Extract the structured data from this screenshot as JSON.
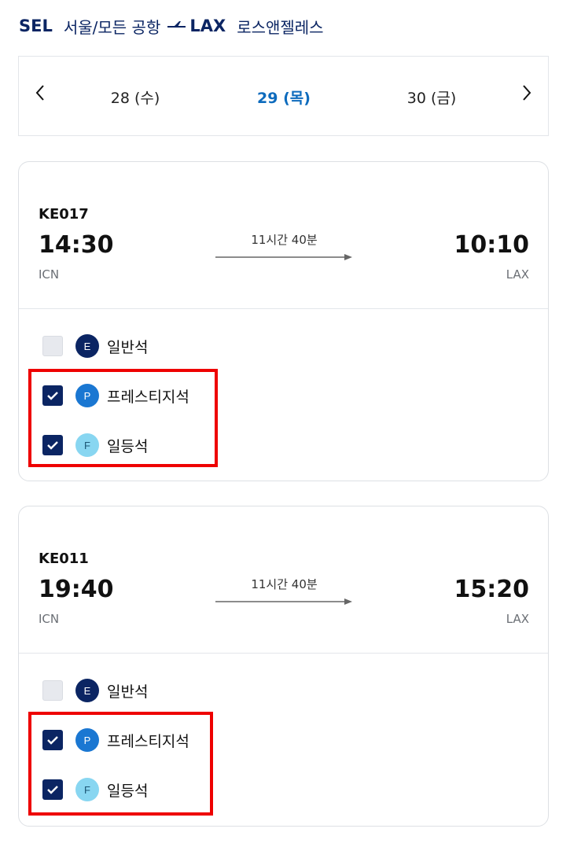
{
  "route": {
    "origin_code": "SEL",
    "origin_name": "서울/모든 공항",
    "dest_code": "LAX",
    "dest_name": "로스앤젤레스"
  },
  "dates": [
    {
      "label": "28 (수)",
      "selected": false
    },
    {
      "label": "29 (목)",
      "selected": true
    },
    {
      "label": "30 (금)",
      "selected": false
    }
  ],
  "flights": [
    {
      "number": "KE017",
      "dep_time": "14:30",
      "dep_airport": "ICN",
      "duration": "11시간 40분",
      "arr_time": "10:10",
      "arr_airport": "LAX",
      "cabins": [
        {
          "badge": "E",
          "label": "일반석",
          "checked": false
        },
        {
          "badge": "P",
          "label": "프레스티지석",
          "checked": true
        },
        {
          "badge": "F",
          "label": "일등석",
          "checked": true
        }
      ]
    },
    {
      "number": "KE011",
      "dep_time": "19:40",
      "dep_airport": "ICN",
      "duration": "11시간 40분",
      "arr_time": "15:20",
      "arr_airport": "LAX",
      "cabins": [
        {
          "badge": "E",
          "label": "일반석",
          "checked": false
        },
        {
          "badge": "P",
          "label": "프레스티지석",
          "checked": true
        },
        {
          "badge": "F",
          "label": "일등석",
          "checked": true
        }
      ]
    }
  ],
  "icons": {
    "route": "plane-arrow-icon",
    "prev": "chevron-left-icon",
    "next": "chevron-right-icon",
    "check": "checkmark-icon"
  },
  "colors": {
    "brand_navy": "#0b2563",
    "selected_date": "#0d6bbd",
    "economy_badge": "#0b2563",
    "prestige_badge": "#1a77d2",
    "first_badge": "#88d6f1",
    "highlight": "#ee0000"
  }
}
